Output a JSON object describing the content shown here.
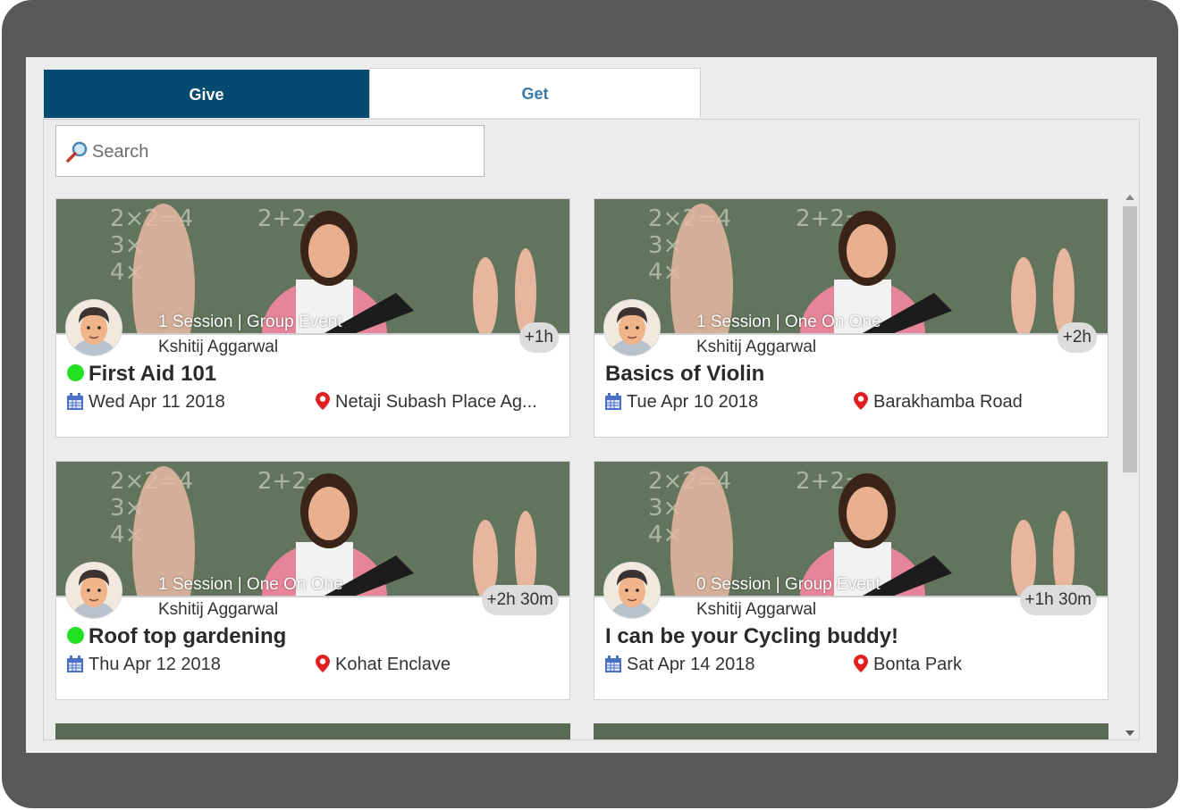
{
  "tabs": {
    "give": "Give",
    "get": "Get"
  },
  "search": {
    "placeholder": "Search"
  },
  "cards": [
    {
      "session": "1 Session | Group Event",
      "author": "Kshitij Aggarwal",
      "duration": "+1h",
      "title": "First Aid 101",
      "online": true,
      "date": "Wed Apr 11 2018",
      "location": "Netaji Subash Place Ag..."
    },
    {
      "session": "1 Session | One On One",
      "author": "Kshitij Aggarwal",
      "duration": "+2h",
      "title": "Basics of Violin",
      "online": false,
      "date": "Tue Apr 10 2018",
      "location": "Barakhamba Road"
    },
    {
      "session": "1 Session | One On One",
      "author": "Kshitij Aggarwal",
      "duration": "+2h 30m",
      "title": "Roof top gardening",
      "online": true,
      "date": "Thu Apr 12 2018",
      "location": "Kohat Enclave"
    },
    {
      "session": "0 Session | Group Event",
      "author": "Kshitij Aggarwal",
      "duration": "+1h 30m",
      "title": "I can be your Cycling buddy!",
      "online": false,
      "date": "Sat Apr 14 2018",
      "location": "Bonta Park"
    }
  ],
  "colors": {
    "tab_active": "#054a70",
    "online_dot": "#22e022",
    "location_pin": "#e02020",
    "calendar": "#4a6fc4"
  }
}
